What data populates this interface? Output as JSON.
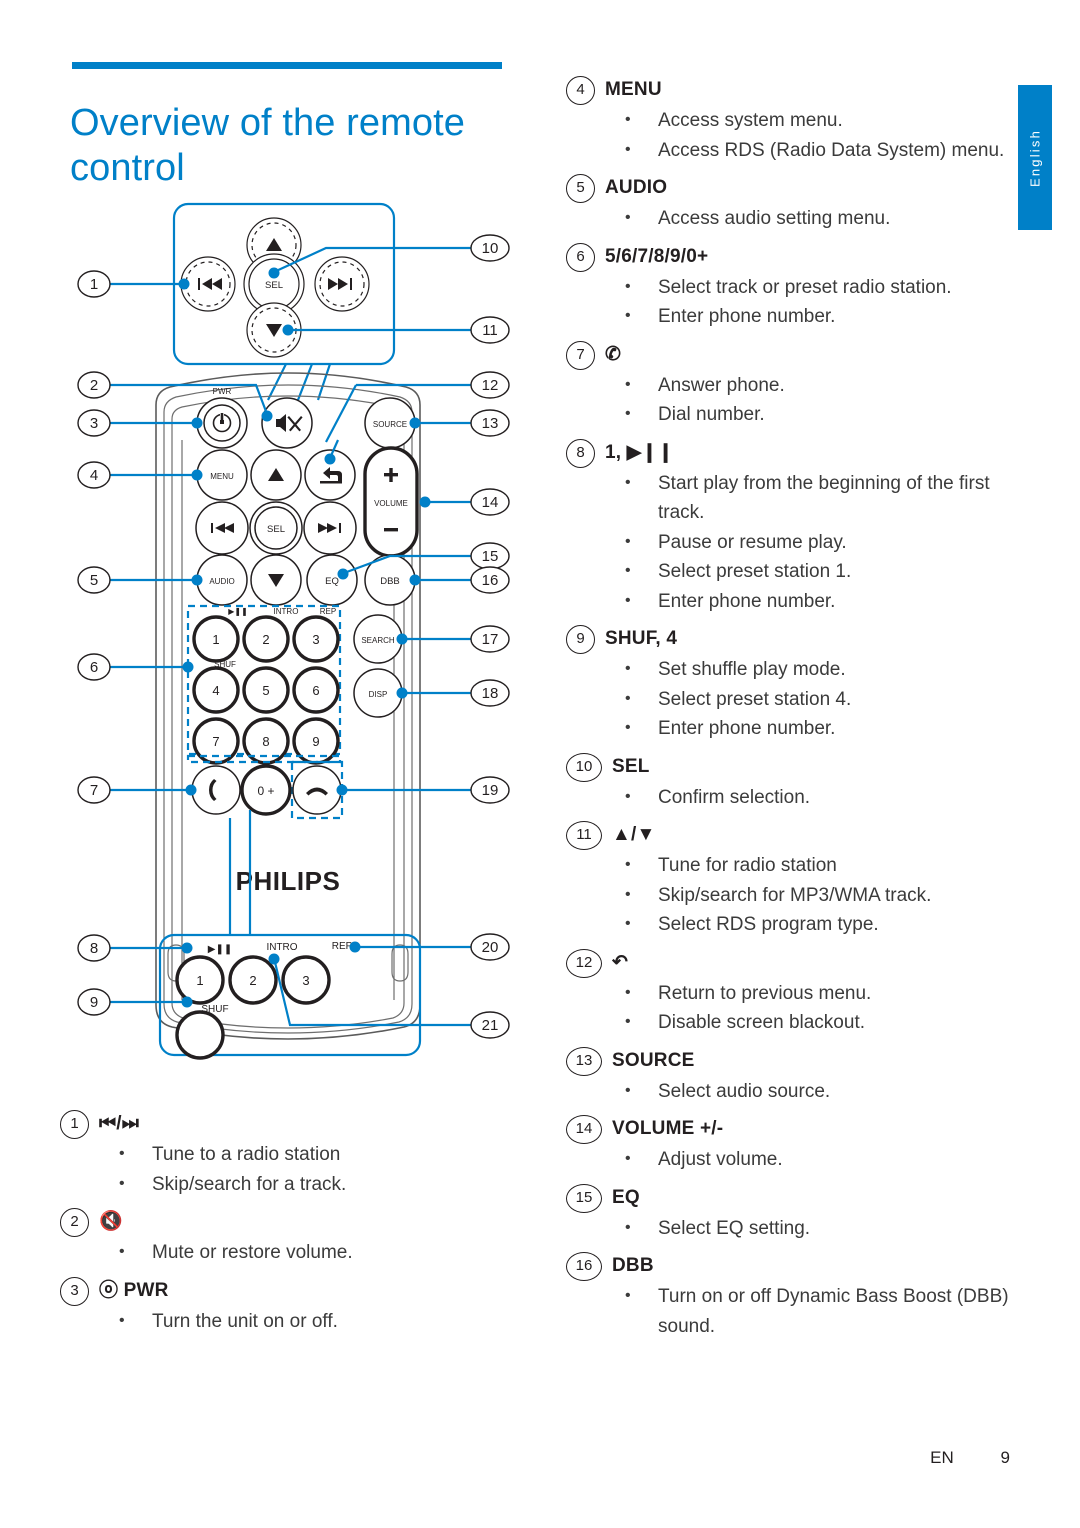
{
  "header": {
    "title": "Overview of the remote control"
  },
  "lang_tab": {
    "label": "English"
  },
  "footer": {
    "en": "EN",
    "page": "9"
  },
  "accent_color": "#0080c8",
  "diagram": {
    "brand": "PHILIPS",
    "callouts_left": [
      "1",
      "2",
      "3",
      "4",
      "5",
      "6",
      "7",
      "8",
      "9"
    ],
    "callouts_right": [
      "10",
      "11",
      "12",
      "13",
      "14",
      "15",
      "16",
      "17",
      "18",
      "19",
      "20",
      "21"
    ],
    "button_labels": {
      "sel": "SEL",
      "pwr": "PWR",
      "menu": "MENU",
      "audio": "AUDIO",
      "source": "SOURCE",
      "volume": "VOLUME",
      "plus": "+",
      "minus": "−",
      "eq": "EQ",
      "dbb": "DBB",
      "search": "SEARCH",
      "disp": "DISP",
      "intro": "INTRO",
      "rep": "REP",
      "shuf": "SHUF",
      "playpause": "▶❙❙",
      "keys": [
        "1",
        "2",
        "3",
        "4",
        "5",
        "6",
        "7",
        "8",
        "9"
      ],
      "zero": "0 +",
      "prev": "◀◀",
      "next": "▶▶",
      "up": "▲",
      "down": "▼"
    }
  },
  "left_list": [
    {
      "num": "1",
      "label": "⏮/⏭",
      "symbol": true,
      "bullets": [
        "Tune to a radio station",
        "Skip/search for a track."
      ]
    },
    {
      "num": "2",
      "label": "🔇",
      "symbol": true,
      "bullets": [
        "Mute or restore volume."
      ]
    },
    {
      "num": "3",
      "label": "ⓞ PWR",
      "symbol": false,
      "bullets": [
        "Turn the unit on or off."
      ]
    }
  ],
  "right_list": [
    {
      "num": "4",
      "label": "MENU",
      "bullets": [
        "Access system menu.",
        "Access RDS (Radio Data System) menu."
      ]
    },
    {
      "num": "5",
      "label": "AUDIO",
      "bullets": [
        "Access audio setting menu."
      ]
    },
    {
      "num": "6",
      "label": "5/6/7/8/9/0+",
      "bullets": [
        "Select track or preset radio station.",
        "Enter phone number."
      ]
    },
    {
      "num": "7",
      "label": "✆",
      "bullets": [
        "Answer phone.",
        "Dial number."
      ]
    },
    {
      "num": "8",
      "label": "1, ▶❙❙",
      "bullets": [
        "Start play from the beginning of the first track.",
        "Pause or resume play.",
        "Select preset station 1.",
        "Enter phone number."
      ]
    },
    {
      "num": "9",
      "label": "SHUF, 4",
      "bullets": [
        "Set shuffle play mode.",
        "Select preset station 4.",
        "Enter phone number."
      ]
    },
    {
      "num": "10",
      "label": "SEL",
      "bullets": [
        "Confirm selection."
      ]
    },
    {
      "num": "11",
      "label": "▲/▼",
      "bullets": [
        "Tune for radio station",
        "Skip/search for MP3/WMA track.",
        "Select RDS program type."
      ]
    },
    {
      "num": "12",
      "label": "↶",
      "bullets": [
        "Return to previous menu.",
        "Disable screen blackout."
      ]
    },
    {
      "num": "13",
      "label": "SOURCE",
      "bullets": [
        "Select audio source."
      ]
    },
    {
      "num": "14",
      "label": "VOLUME +/-",
      "bullets": [
        "Adjust volume."
      ]
    },
    {
      "num": "15",
      "label": "EQ",
      "bullets": [
        "Select EQ setting."
      ]
    },
    {
      "num": "16",
      "label": "DBB",
      "bullets": [
        "Turn on or off Dynamic Bass Boost (DBB) sound."
      ]
    }
  ]
}
